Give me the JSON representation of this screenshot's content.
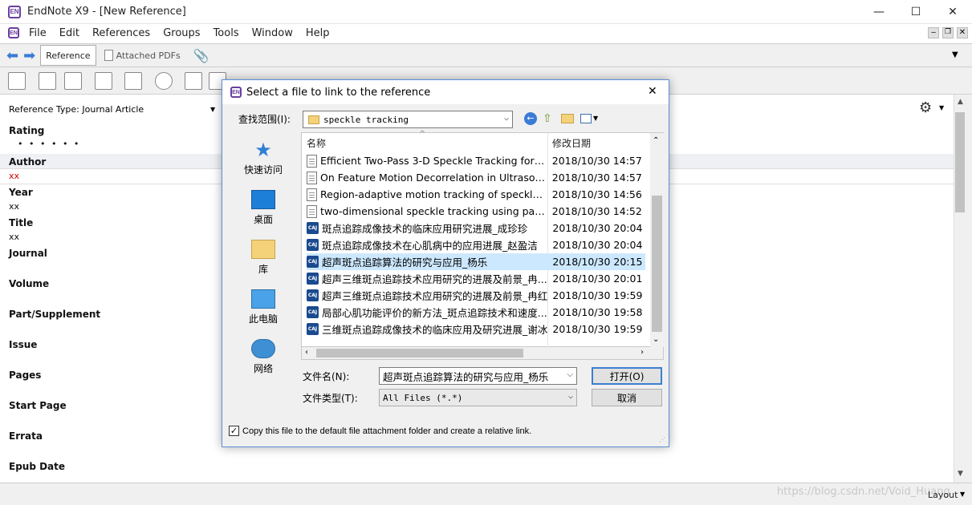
{
  "window": {
    "title": "EndNote X9 - [New Reference]",
    "app_badge": "EN",
    "minimize": "—",
    "maximize": "☐",
    "close": "✕"
  },
  "menu": [
    "File",
    "Edit",
    "References",
    "Groups",
    "Tools",
    "Window",
    "Help"
  ],
  "tabs": {
    "reference": "Reference",
    "attached_pdfs": "Attached PDFs"
  },
  "reference": {
    "type_label": "Reference Type:",
    "type_value": "Journal Article",
    "rating_label": "Rating",
    "rating_value": "• • • • • •",
    "author_label": "Author",
    "author_value": "xx",
    "year_label": "Year",
    "year_value": "xx",
    "title_label": "Title",
    "title_value": "xx",
    "journal_label": "Journal",
    "volume_label": "Volume",
    "part_label": "Part/Supplement",
    "issue_label": "Issue",
    "pages_label": "Pages",
    "start_page_label": "Start Page",
    "errata_label": "Errata",
    "epub_label": "Epub Date"
  },
  "statusbar": {
    "watermark": "https://blog.csdn.net/Void_Huang",
    "layout": "Layout"
  },
  "dialog": {
    "title": "Select a file to link to the reference",
    "lookin_label": "查找范围(I):",
    "lookin_value": "speckle tracking",
    "places": [
      "快速访问",
      "桌面",
      "库",
      "此电脑",
      "网络"
    ],
    "col_name": "名称",
    "col_date": "修改日期",
    "files": [
      {
        "name": "Efficient Two-Pass 3-D Speckle Tracking for U...",
        "date": "2018/10/30 14:57",
        "kind": "pdf"
      },
      {
        "name": "On Feature Motion Decorrelation in Ultrasoun...",
        "date": "2018/10/30 14:57",
        "kind": "pdf"
      },
      {
        "name": "Region-adaptive motion tracking of speckle i...",
        "date": "2018/10/30 14:56",
        "kind": "pdf"
      },
      {
        "name": "two-dimensional speckle tracking using para...",
        "date": "2018/10/30 14:52",
        "kind": "pdf"
      },
      {
        "name": "斑点追踪成像技术的临床应用研究进展_成珍珍",
        "date": "2018/10/30 20:04",
        "kind": "caj"
      },
      {
        "name": "斑点追踪成像技术在心肌病中的应用进展_赵盈洁",
        "date": "2018/10/30 20:04",
        "kind": "caj"
      },
      {
        "name": "超声斑点追踪算法的研究与应用_杨乐",
        "date": "2018/10/30 20:15",
        "kind": "caj",
        "selected": true
      },
      {
        "name": "超声三维斑点追踪技术应用研究的进展及前景_冉...",
        "date": "2018/10/30 20:01",
        "kind": "caj"
      },
      {
        "name": "超声三维斑点追踪技术应用研究的进展及前景_冉红",
        "date": "2018/10/30 19:59",
        "kind": "caj"
      },
      {
        "name": "局部心肌功能评价的新方法_斑点追踪技术和速度...",
        "date": "2018/10/30 19:58",
        "kind": "caj"
      },
      {
        "name": "三维斑点追踪成像技术的临床应用及研究进展_谢冰",
        "date": "2018/10/30 19:59",
        "kind": "caj"
      }
    ],
    "filename_label": "文件名(N):",
    "filename_value": "超声斑点追踪算法的研究与应用_杨乐",
    "filetype_label": "文件类型(T):",
    "filetype_value": "All Files (*.*)",
    "open_button": "打开(O)",
    "cancel_button": "取消",
    "copy_checkbox_label": "Copy this file to the default file attachment folder and create a relative link.",
    "copy_checked": true,
    "close": "✕"
  }
}
